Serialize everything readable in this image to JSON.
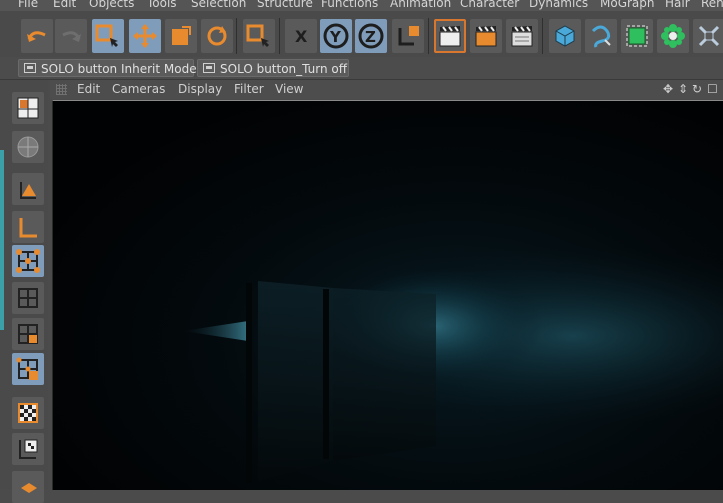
{
  "menu": [
    "File",
    "Edit",
    "Objects",
    "Tools",
    "Selection",
    "Structure",
    "Functions",
    "Animation",
    "Character",
    "Dynamics",
    "MoGraph",
    "Hair",
    "Ren"
  ],
  "toolbar_icons": [
    "undo-icon",
    "redo-icon",
    "live-selection-icon",
    "move-icon",
    "scale-icon",
    "rotate-icon",
    "selection-tool-icon",
    "x-axis-icon",
    "y-axis-icon",
    "z-axis-icon",
    "coordinate-system-icon",
    "render-view-icon",
    "render-picture-viewer-icon",
    "render-settings-icon",
    "cube-icon",
    "spline-pen-icon",
    "subdivision-surface-icon",
    "cloner-icon",
    "deformer-icon"
  ],
  "solo_buttons": [
    "SOLO button Inherit Mode",
    "SOLO button_Turn off"
  ],
  "left_icons": [
    "layout-icon",
    "globe-model-icon",
    "object-axis-icon",
    "axis-tool-icon",
    "points-mode-icon",
    "edges-mode-icon",
    "polygons-mode-icon",
    "uv-points-icon",
    "texture-mode-icon",
    "workplane-icon",
    "spline-mode-icon"
  ],
  "viewport_menu": [
    "Edit",
    "Cameras",
    "Display",
    "Filter",
    "View"
  ],
  "colors": {
    "accent_orange": "#e88a2e",
    "active_blue": "#7f9dbb",
    "panel": "#4a4a4a",
    "viewport_bg": "#010203",
    "light_glow": "#2f6e80"
  }
}
